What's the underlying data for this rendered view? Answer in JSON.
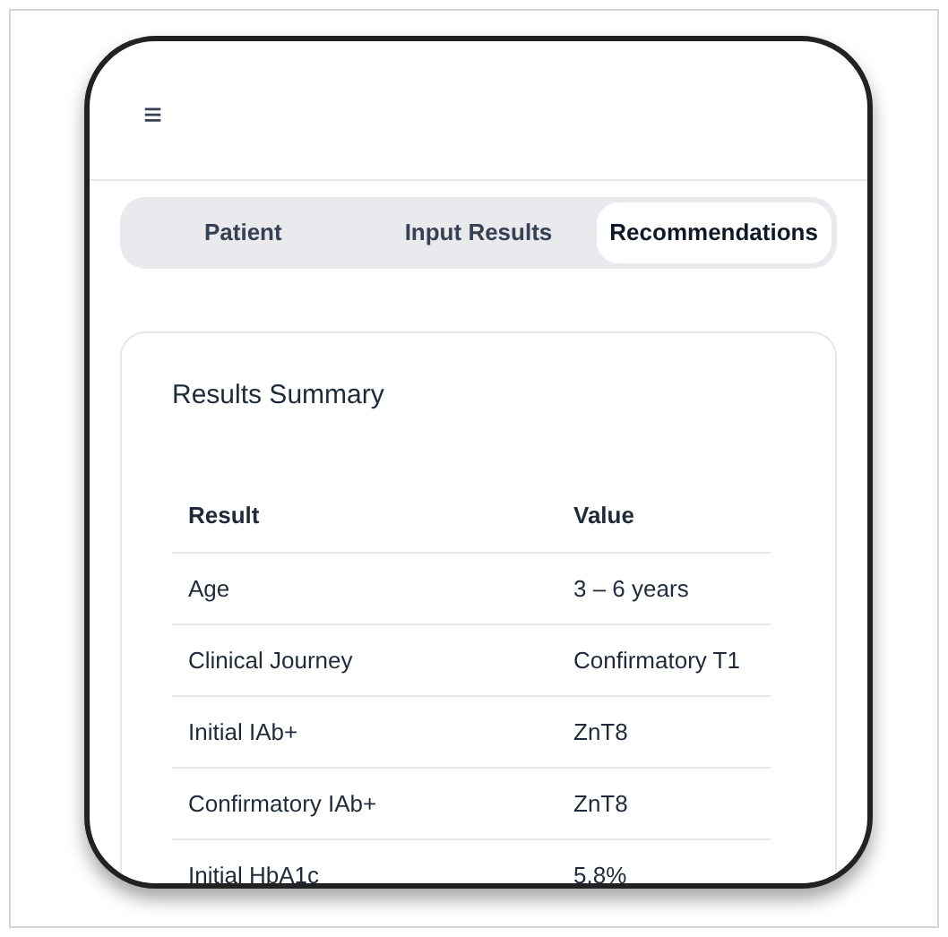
{
  "menu_icon": "≡",
  "tabs": [
    {
      "label": "Patient",
      "selected": false
    },
    {
      "label": "Input Results",
      "selected": false
    },
    {
      "label": "Recommendations",
      "selected": true
    }
  ],
  "card": {
    "title": "Results Summary",
    "table": {
      "columns": [
        "Result",
        "Value"
      ],
      "rows": [
        [
          "Age",
          "3 – 6 years"
        ],
        [
          "Clinical Journey",
          "Confirmatory T1"
        ],
        [
          "Initial IAb+",
          "ZnT8"
        ],
        [
          "Confirmatory IAb+",
          "ZnT8"
        ],
        [
          "Initial HbA1c",
          "5.8%"
        ]
      ]
    }
  }
}
